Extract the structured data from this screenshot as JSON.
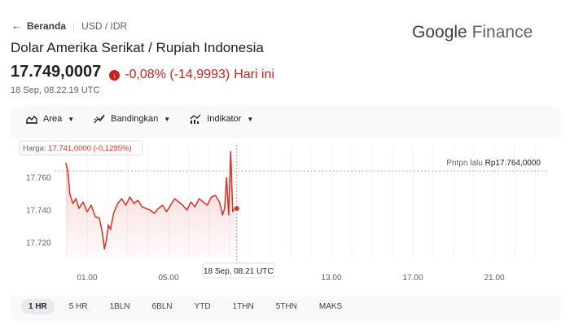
{
  "breadcrumb": {
    "home": "Beranda",
    "pair": "USD / IDR"
  },
  "brand": {
    "word1": "Google",
    "word2": "Finance"
  },
  "title": "Dolar Amerika Serikat / Rupiah Indonesia",
  "quote": {
    "price": "17.749,0007",
    "change": "-0,08% (-14,9993)",
    "period": "Hari ini",
    "timestamp": "18 Sep, 08.22.19 UTC",
    "change_color": "#c5221f"
  },
  "toolbar": {
    "area_label": "Area",
    "compare_label": "Bandingkan",
    "indicator_label": "Indikator"
  },
  "tooltip": {
    "label": "Harga: 17.741,0000 (-0,1295%)",
    "time": "18 Sep, 08.21 UTC"
  },
  "prev_close": {
    "label": "Pntpn lalu",
    "value": "Rp17.764,0000"
  },
  "ranges": [
    "1 HR",
    "5 HR",
    "1BLN",
    "6BLN",
    "YTD",
    "1THN",
    "5THN",
    "MAKS"
  ],
  "active_range": "1 HR",
  "chart_data": {
    "type": "area",
    "series_color": "#d93025",
    "y_tick_labels": [
      "17.760",
      "17.740",
      "17.720"
    ],
    "y_ticks": [
      17760,
      17740,
      17720
    ],
    "x_tick_labels": [
      "01.00",
      "05.00",
      "13.00",
      "17.00",
      "21.00"
    ],
    "x_ticks_hours": [
      1,
      5,
      13,
      17,
      21
    ],
    "x_range_hours": [
      -0.6,
      23.6
    ],
    "ylim": [
      17711,
      17780
    ],
    "prev_close": 17764,
    "hover_hours": 8.35,
    "x_hours": [
      -0.05,
      0.05,
      0.15,
      0.3,
      0.45,
      0.6,
      0.8,
      1.0,
      1.2,
      1.4,
      1.6,
      1.75,
      1.85,
      1.95,
      2.05,
      2.15,
      2.3,
      2.5,
      2.7,
      2.9,
      3.1,
      3.3,
      3.5,
      3.7,
      3.9,
      4.1,
      4.3,
      4.5,
      4.7,
      4.9,
      5.1,
      5.3,
      5.5,
      5.7,
      5.9,
      6.1,
      6.3,
      6.5,
      6.7,
      6.9,
      7.1,
      7.3,
      7.5,
      7.65,
      7.75,
      7.85,
      7.95,
      8.05,
      8.15,
      8.25,
      8.35
    ],
    "values": [
      17769,
      17764,
      17750,
      17744,
      17747,
      17741,
      17745,
      17739,
      17743,
      17736,
      17735,
      17726,
      17716,
      17722,
      17731,
      17728,
      17738,
      17744,
      17747,
      17743,
      17748,
      17744,
      17746,
      17742,
      17741,
      17740,
      17738,
      17741,
      17743,
      17739,
      17743,
      17747,
      17745,
      17743,
      17740,
      17745,
      17742,
      17747,
      17745,
      17743,
      17748,
      17749,
      17745,
      17737,
      17741,
      17760,
      17737,
      17776,
      17739,
      17742,
      17741
    ]
  }
}
